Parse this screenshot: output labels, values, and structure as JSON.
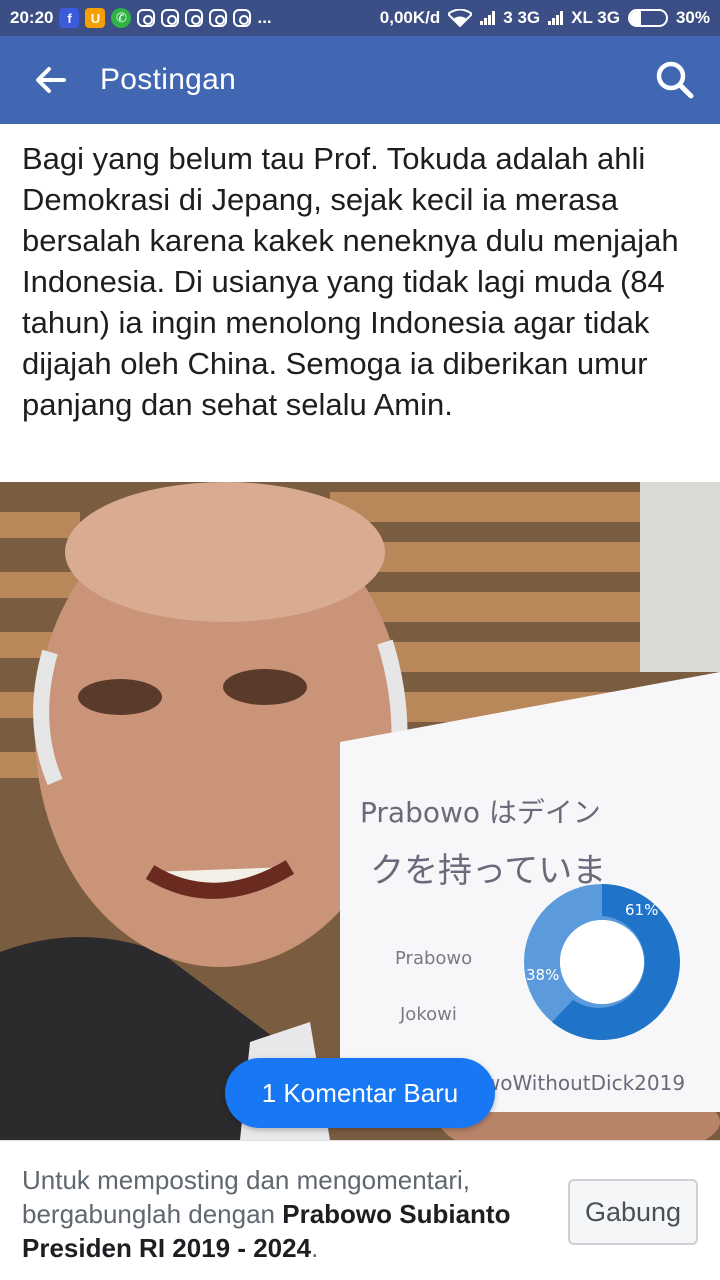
{
  "status_bar": {
    "time": "20:20",
    "more": "...",
    "speed": "0,00K/d",
    "sim1": "3 3G",
    "sim2": "XL 3G",
    "battery": "30%",
    "battery_level": 0.3,
    "notification_icons": [
      "facebook-icon",
      "uc-browser-icon",
      "whatsapp-icon",
      "instagram-icon",
      "instagram-icon",
      "instagram-icon",
      "instagram-icon",
      "instagram-icon"
    ]
  },
  "app_bar": {
    "title": "Postingan",
    "back_icon": "arrow-left-icon",
    "search_icon": "search-icon",
    "bg_color": "#4267b2"
  },
  "post": {
    "text": "Bagi yang belum tau Prof. Tokuda adalah ahli Demokrasi di Jepang, sejak kecil ia merasa bersalah karena kakek neneknya dulu menjajah Indonesia. Di usianya yang tidak lagi muda (84 tahun) ia ingin menolong Indonesia agar tidak dijajah oleh China. Semoga ia diberikan umur panjang dan sehat selalu Amin."
  },
  "image": {
    "sign_line1": "Prabowo はデイン",
    "sign_line2": "クを持っていま",
    "legend_a": "Prabowo",
    "legend_b": "Jokowi",
    "slice_a_label": "38%",
    "slice_b_label": "61%",
    "hashtag": "#PrabowoWithoutDick2019"
  },
  "new_comments_button": "1 Komentar Baru",
  "footer": {
    "text_prefix": "Untuk memposting dan mengomentari, bergabunglah dengan ",
    "group_name": "Prabowo Subianto Presiden RI 2019 - 2024",
    "text_suffix": ".",
    "join_button": "Gabung"
  }
}
